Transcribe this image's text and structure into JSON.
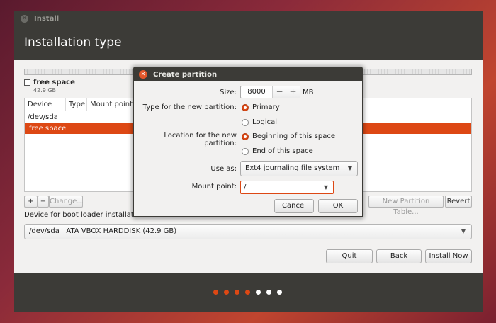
{
  "window": {
    "title": "Install",
    "page_title": "Installation type"
  },
  "disk": {
    "legend_label": "free space",
    "legend_size": "42.9 GB"
  },
  "table": {
    "columns": [
      "Device",
      "Type",
      "Mount point"
    ],
    "rows": [
      {
        "device": "/dev/sda"
      },
      {
        "device": "free space",
        "selected": true
      }
    ]
  },
  "toolbar": {
    "add": "+",
    "remove": "−",
    "change": "Change...",
    "new_partition_table": "New Partition Table...",
    "revert": "Revert"
  },
  "boot_loader": {
    "label": "Device for boot loader installation:",
    "selected": "/dev/sda   ATA VBOX HARDDISK (42.9 GB)"
  },
  "buttons": {
    "quit": "Quit",
    "back": "Back",
    "install_now": "Install Now"
  },
  "progress": {
    "total_steps": 7,
    "completed_steps": 4,
    "active_color": "#dd4814",
    "inactive_color": "#ffffff"
  },
  "dialog": {
    "title": "Create partition",
    "size_label": "Size:",
    "size_value": "8000",
    "size_unit": "MB",
    "decrement": "−",
    "increment": "+",
    "type_label": "Type for the new partition:",
    "type_options": [
      "Primary",
      "Logical"
    ],
    "type_selected": "Primary",
    "location_label": "Location for the new partition:",
    "location_options": [
      "Beginning of this space",
      "End of this space"
    ],
    "location_selected": "Beginning of this space",
    "use_as_label": "Use as:",
    "use_as_value": "Ext4 journaling file system",
    "mount_label": "Mount point:",
    "mount_value": "/",
    "cancel": "Cancel",
    "ok": "OK"
  },
  "colors": {
    "accent": "#dd4814",
    "header_bg": "#3c3b37",
    "content_bg": "#f2f1f0"
  }
}
